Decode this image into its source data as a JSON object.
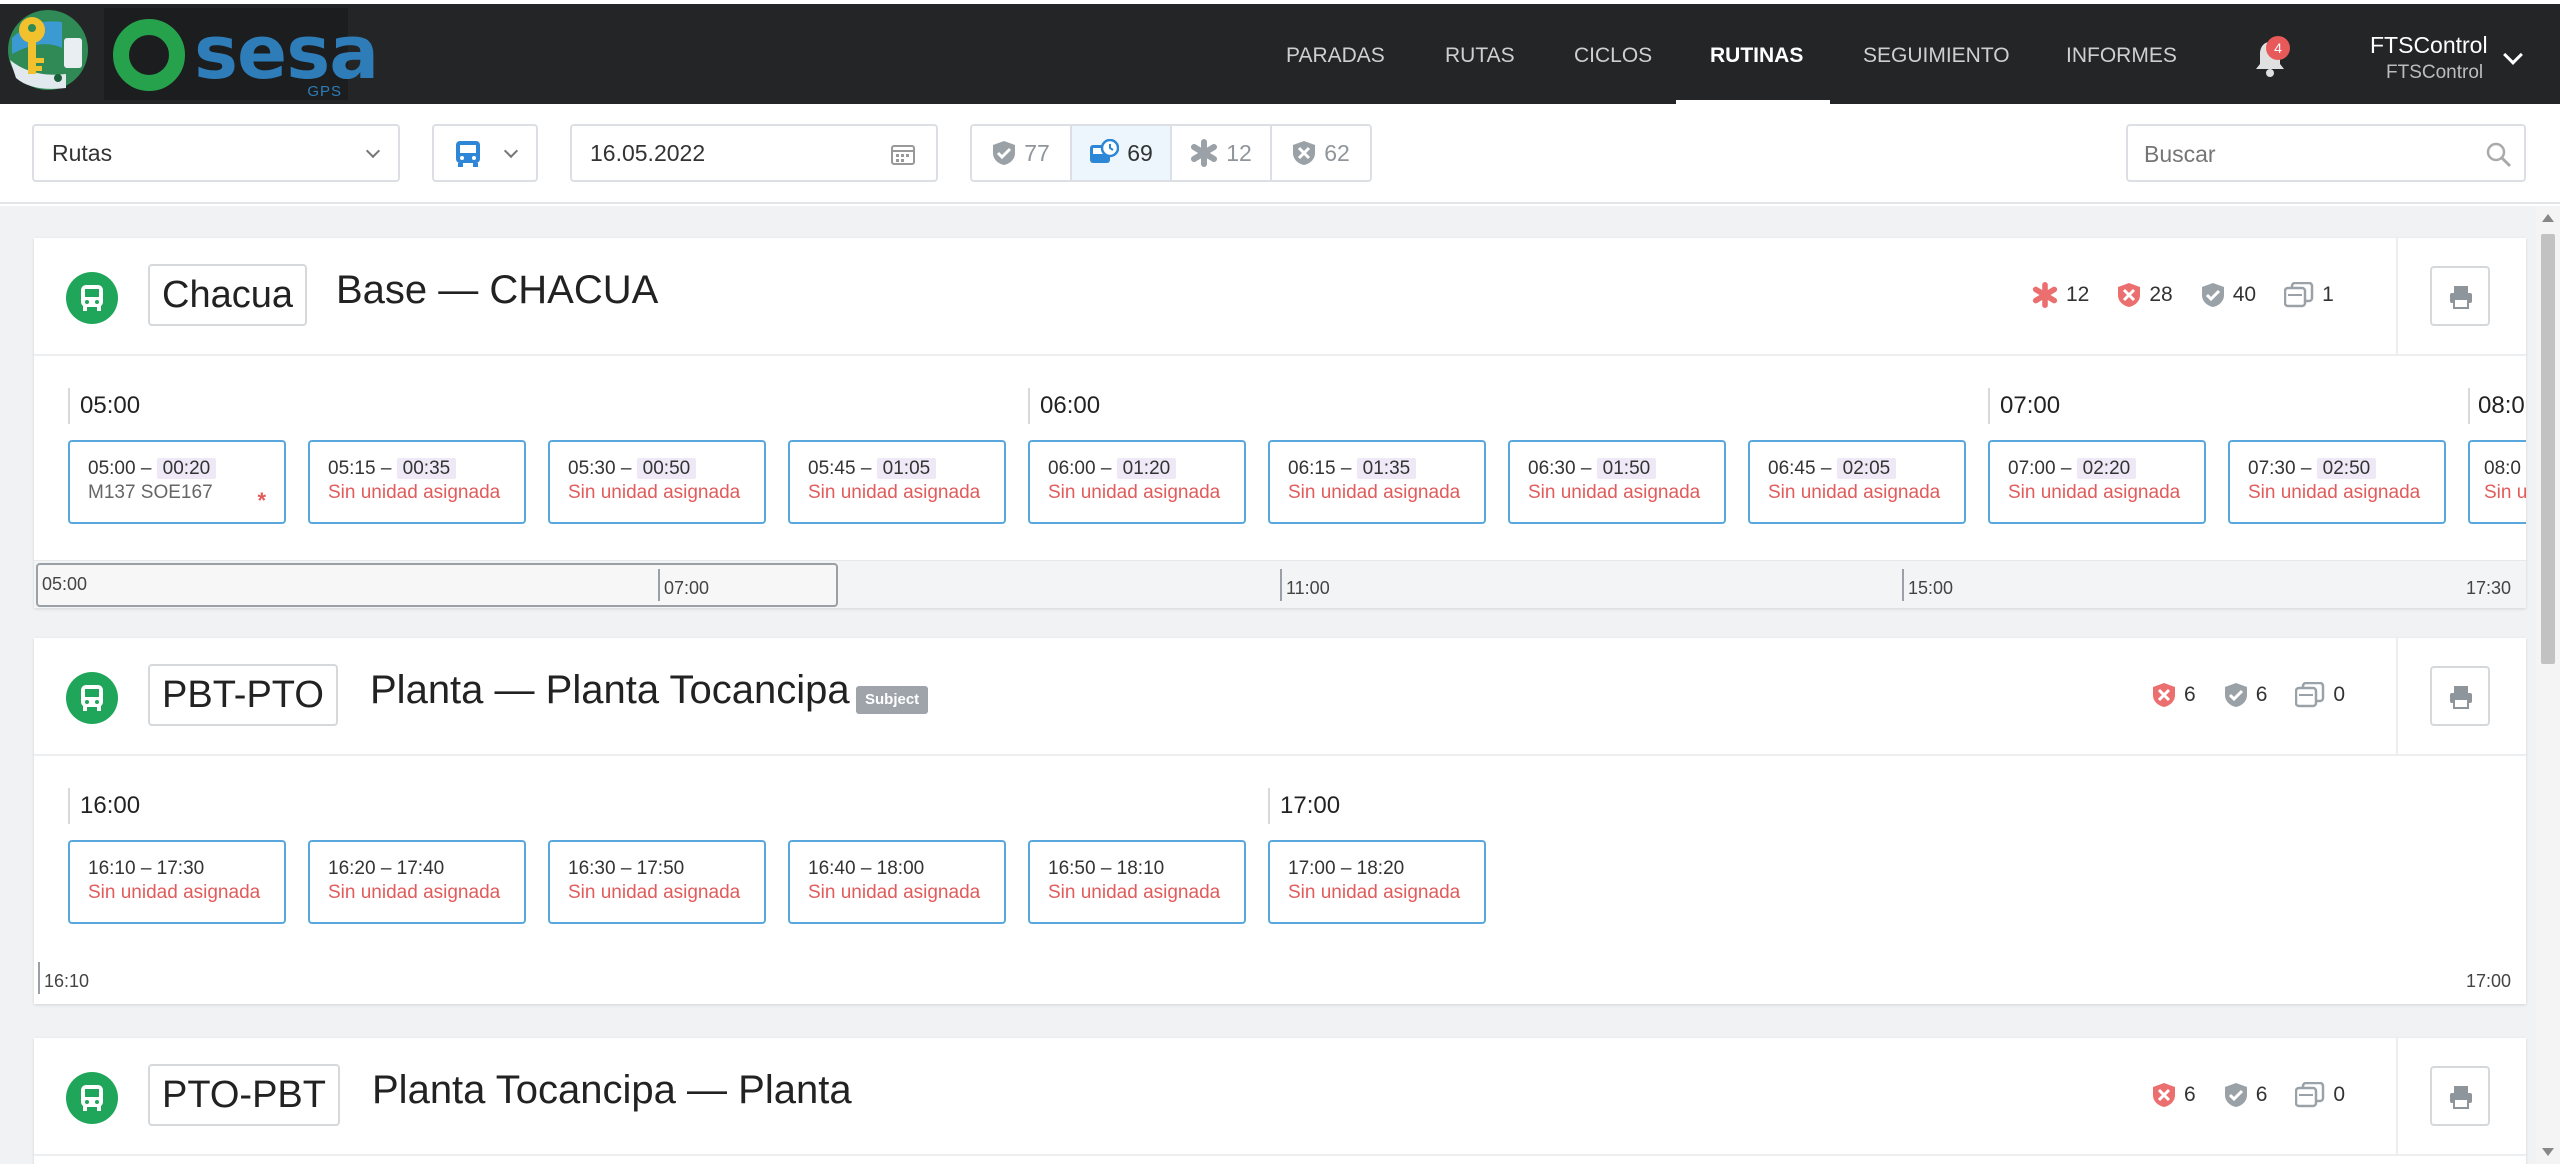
{
  "header": {
    "logo_text": "sesa",
    "logo_sub": "GPS",
    "nav": [
      {
        "label": "PARADAS",
        "active": false
      },
      {
        "label": "RUTAS",
        "active": false
      },
      {
        "label": "CICLOS",
        "active": false
      },
      {
        "label": "RUTINAS",
        "active": true
      },
      {
        "label": "SEGUIMIENTO",
        "active": false
      },
      {
        "label": "INFORMES",
        "active": false
      }
    ],
    "notifications": "4",
    "user_name": "FTSControl",
    "user_sub": "FTSControl"
  },
  "toolbar": {
    "view_select": "Rutas",
    "date": "16.05.2022",
    "filters": [
      {
        "icon": "shield-check-icon",
        "count": "77"
      },
      {
        "icon": "bus-clock-icon",
        "count": "69"
      },
      {
        "icon": "asterisk-icon",
        "count": "12"
      },
      {
        "icon": "shield-x-icon",
        "count": "62"
      }
    ],
    "search_placeholder": "Buscar"
  },
  "routes": [
    {
      "code": "Chacua",
      "name": "Base — CHACUA",
      "subject": "",
      "stats": {
        "asterisk": "12",
        "cancelled": "28",
        "ok": "40",
        "buses": "1"
      },
      "hours": [
        "05:00",
        "06:00",
        "07:00",
        "08:0"
      ],
      "trips": [
        {
          "start": "05:00",
          "end": "00:20",
          "sub": "M137 SOE167",
          "assigned": true
        },
        {
          "start": "05:15",
          "end": "00:35",
          "sub": "Sin unidad asignada"
        },
        {
          "start": "05:30",
          "end": "00:50",
          "sub": "Sin unidad asignada"
        },
        {
          "start": "05:45",
          "end": "01:05",
          "sub": "Sin unidad asignada"
        },
        {
          "start": "06:00",
          "end": "01:20",
          "sub": "Sin unidad asignada"
        },
        {
          "start": "06:15",
          "end": "01:35",
          "sub": "Sin unidad asignada"
        },
        {
          "start": "06:30",
          "end": "01:50",
          "sub": "Sin unidad asignada"
        },
        {
          "start": "06:45",
          "end": "02:05",
          "sub": "Sin unidad asignada"
        },
        {
          "start": "07:00",
          "end": "02:20",
          "sub": "Sin unidad asignada"
        },
        {
          "start": "07:30",
          "end": "02:50",
          "sub": "Sin unidad asignada"
        },
        {
          "start": "08:0",
          "end": "",
          "sub": "Sin u"
        }
      ],
      "timeline": [
        "05:00",
        "07:00",
        "11:00",
        "15:00",
        "17:30"
      ]
    },
    {
      "code": "PBT-PTO",
      "name": "Planta — Planta Tocancipa",
      "subject": "Subject",
      "stats": {
        "cancelled": "6",
        "ok": "6",
        "buses": "0"
      },
      "hours": [
        "16:00",
        "17:00"
      ],
      "trips": [
        {
          "start": "16:10",
          "end": "17:30",
          "sub": "Sin unidad asignada"
        },
        {
          "start": "16:20",
          "end": "17:40",
          "sub": "Sin unidad asignada"
        },
        {
          "start": "16:30",
          "end": "17:50",
          "sub": "Sin unidad asignada"
        },
        {
          "start": "16:40",
          "end": "18:00",
          "sub": "Sin unidad asignada"
        },
        {
          "start": "16:50",
          "end": "18:10",
          "sub": "Sin unidad asignada"
        },
        {
          "start": "17:00",
          "end": "18:20",
          "sub": "Sin unidad asignada"
        }
      ],
      "timeline": [
        "16:10",
        "17:00"
      ]
    },
    {
      "code": "PTO-PBT",
      "name": "Planta Tocancipa — Planta",
      "subject": "",
      "stats": {
        "cancelled": "6",
        "ok": "6",
        "buses": "0"
      }
    }
  ]
}
